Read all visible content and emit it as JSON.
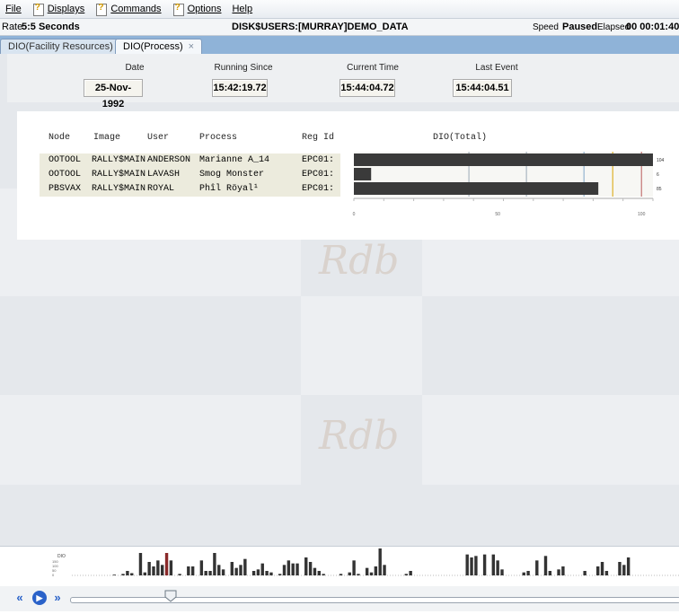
{
  "menu": {
    "file": "File",
    "displays": "Displays",
    "commands": "Commands",
    "options": "Options",
    "help": "Help"
  },
  "status": {
    "rate_label": "Rate",
    "rate_value": "5:5 Seconds",
    "path": "DISK$USERS:[MURRAY]DEMO_DATA",
    "speed_label": "Speed",
    "state": "Paused",
    "elapsed_label": "Elapsed",
    "elapsed_value": "00 00:01:40"
  },
  "tabs": [
    {
      "label": "DIO(Facility Resources)",
      "active": false
    },
    {
      "label": "DIO(Process)",
      "active": true,
      "close": "×"
    }
  ],
  "info": {
    "date_label": "Date",
    "date_value": "25-Nov-1992",
    "running_label": "Running Since",
    "running_value": "15:42:19.72",
    "current_label": "Current Time",
    "current_value": "15:44:04.72",
    "last_label": "Last Event",
    "last_value": "15:44:04.51"
  },
  "watermark": "Rdb",
  "table": {
    "headers": [
      "Node",
      "Image",
      "User",
      "Process",
      "Reg Id",
      "DIO(Total)"
    ],
    "rows": [
      {
        "node": "OOTOOL",
        "image": "RALLY$MAIN",
        "user": "ANDERSON",
        "process": "Marianne A_14",
        "regid": "EPC01:",
        "value": 104
      },
      {
        "node": "OOTOOL",
        "image": "RALLY$MAIN",
        "user": "LAVASH",
        "process": "Smog Monster",
        "regid": "EPC01:",
        "value": 6
      },
      {
        "node": "PBSVAX",
        "image": "RALLY$MAIN",
        "user": "ROYAL",
        "process": "Phîl Röyal¹",
        "regid": "EPC01:",
        "value": 85
      }
    ]
  },
  "chart_data": {
    "type": "bar",
    "orientation": "horizontal",
    "categories": [
      "Marianne A_14",
      "Smog Monster",
      "Phîl Röyal¹"
    ],
    "values": [
      104,
      6,
      85
    ],
    "xlim": [
      0,
      104
    ],
    "xticks": [
      "0",
      "50",
      "100"
    ],
    "reference_lines": [
      40,
      60,
      80,
      90,
      100
    ],
    "bar_color": "#3a3a3a"
  },
  "history": {
    "label": "DIO",
    "yticks": [
      "150",
      "100",
      "50",
      "0"
    ],
    "values": [
      0,
      0,
      0,
      0,
      0,
      0,
      0,
      0,
      0,
      1,
      0,
      2,
      6,
      3,
      0,
      30,
      4,
      18,
      12,
      20,
      14,
      30,
      20,
      0,
      2,
      0,
      12,
      12,
      0,
      20,
      6,
      6,
      30,
      14,
      8,
      0,
      18,
      10,
      14,
      22,
      0,
      6,
      8,
      16,
      6,
      4,
      0,
      2,
      14,
      20,
      16,
      16,
      0,
      24,
      18,
      10,
      6,
      2,
      0,
      0,
      0,
      2,
      0,
      4,
      20,
      2,
      0,
      10,
      4,
      12,
      36,
      14,
      0,
      0,
      0,
      0,
      2,
      6,
      0,
      0,
      0,
      0,
      0,
      0,
      0,
      0,
      0,
      0,
      0,
      0,
      28,
      24,
      26,
      0,
      28,
      0,
      28,
      20,
      8,
      0,
      0,
      0,
      0,
      4,
      6,
      0,
      20,
      0,
      26,
      6,
      0,
      8,
      12,
      0,
      0,
      0,
      0,
      6,
      0,
      0,
      12,
      18,
      6,
      0,
      0,
      18,
      14,
      24,
      0,
      0,
      0,
      0,
      0,
      0,
      0,
      0,
      0,
      0,
      0,
      16
    ]
  },
  "colors": {
    "accent": "#2a62c9",
    "tab_strip": "#8fb3d8",
    "history_marker": "#8a2a2a"
  },
  "icons": {
    "menu_doc": "document-question-icon",
    "rewind": "rewind-icon",
    "play": "play-icon",
    "forward": "fast-forward-icon"
  }
}
